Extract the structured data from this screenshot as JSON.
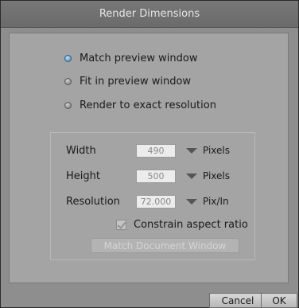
{
  "dialog": {
    "title": "Render Dimensions"
  },
  "render_mode": {
    "options": [
      {
        "label": "Match preview window",
        "selected": true
      },
      {
        "label": "Fit in preview window",
        "selected": false
      },
      {
        "label": "Render to exact resolution",
        "selected": false
      }
    ]
  },
  "fields": {
    "width": {
      "label": "Width",
      "value": "490",
      "unit": "Pixels"
    },
    "height": {
      "label": "Height",
      "value": "500",
      "unit": "Pixels"
    },
    "resolution": {
      "label": "Resolution",
      "value": "72.000",
      "unit": "Pix/In"
    }
  },
  "constrain": {
    "label": "Constrain aspect ratio",
    "checked": true
  },
  "match_button": {
    "label": "Match Document Window"
  },
  "footer": {
    "cancel_label": "Cancel",
    "ok_label": "OK"
  },
  "colors": {
    "accent_radio": "#2e7fb0",
    "dialog_bg": "#a4a4a4"
  }
}
